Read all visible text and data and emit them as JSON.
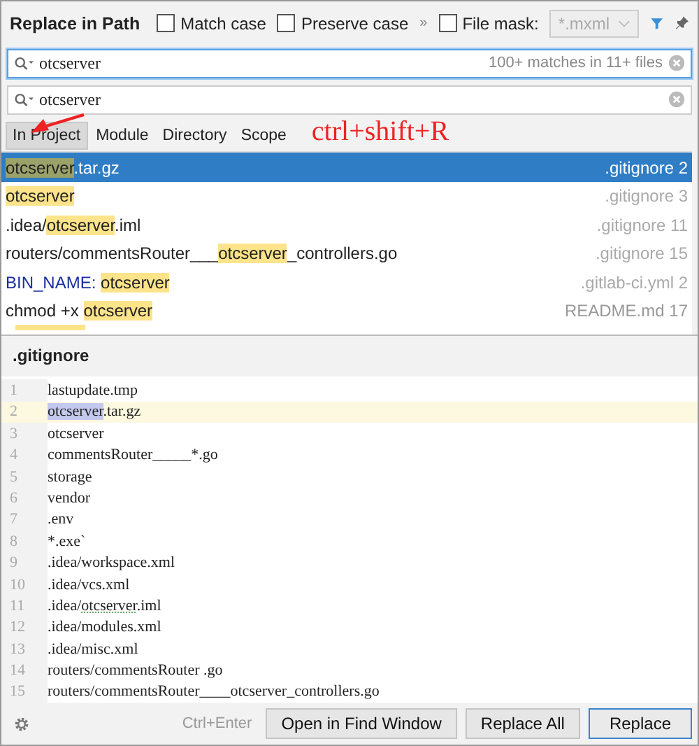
{
  "header": {
    "title": "Replace in Path",
    "options": [
      {
        "label": "Match case",
        "checked": false
      },
      {
        "label": "Preserve case",
        "checked": false
      }
    ],
    "more": "»",
    "file_mask": {
      "label": "File mask:",
      "checked": false,
      "value": "*.mxml",
      "disabled": true
    }
  },
  "search": {
    "value": "otcserver",
    "summary": "100+ matches in 11+ files"
  },
  "replace": {
    "value": "otcserver"
  },
  "scopes": [
    {
      "label": "In Project",
      "selected": true
    },
    {
      "label": "Module",
      "selected": false
    },
    {
      "label": "Directory",
      "selected": false
    },
    {
      "label": "Scope",
      "selected": false
    }
  ],
  "annotation": {
    "text": "ctrl+shift+R"
  },
  "results": [
    {
      "selected": true,
      "segments": [
        {
          "text": "otcserver",
          "kind": "match"
        },
        {
          "text": ".tar.gz",
          "kind": "plain"
        }
      ],
      "location": ".gitignore 2"
    },
    {
      "selected": false,
      "segments": [
        {
          "text": "otcserver",
          "kind": "match"
        }
      ],
      "location": ".gitignore 3"
    },
    {
      "selected": false,
      "segments": [
        {
          "text": ".idea/",
          "kind": "plain"
        },
        {
          "text": "otcserver",
          "kind": "match"
        },
        {
          "text": ".iml",
          "kind": "plain"
        }
      ],
      "location": ".gitignore 11"
    },
    {
      "selected": false,
      "segments": [
        {
          "text": "routers/commentsRouter___",
          "kind": "plain"
        },
        {
          "text": "otcserver",
          "kind": "match"
        },
        {
          "text": "_controllers.go",
          "kind": "plain"
        }
      ],
      "location": ".gitignore 15"
    },
    {
      "selected": false,
      "segments": [
        {
          "text": "BIN_NAME: ",
          "kind": "key"
        },
        {
          "text": "otcserver",
          "kind": "match"
        }
      ],
      "location": ".gitlab-ci.yml 2"
    },
    {
      "selected": false,
      "segments": [
        {
          "text": "chmod +x ",
          "kind": "plain"
        },
        {
          "text": "otcserver",
          "kind": "match"
        }
      ],
      "location": "README.md 17"
    }
  ],
  "preview": {
    "file": ".gitignore",
    "lines": [
      {
        "number": "1",
        "current": false,
        "segments": [
          {
            "text": "lastupdate.tmp",
            "kind": "plain"
          }
        ]
      },
      {
        "number": "2",
        "current": true,
        "segments": [
          {
            "text": "otcserver",
            "kind": "selection"
          },
          {
            "text": ".tar.gz",
            "kind": "plain"
          }
        ]
      },
      {
        "number": "3",
        "current": false,
        "segments": [
          {
            "text": "otcserver",
            "kind": "plain"
          }
        ]
      },
      {
        "number": "4",
        "current": false,
        "segments": [
          {
            "text": "commentsRouter_____*.go",
            "kind": "plain"
          }
        ]
      },
      {
        "number": "5",
        "current": false,
        "segments": [
          {
            "text": "storage",
            "kind": "plain"
          }
        ]
      },
      {
        "number": "6",
        "current": false,
        "segments": [
          {
            "text": "vendor",
            "kind": "plain"
          }
        ]
      },
      {
        "number": "7",
        "current": false,
        "segments": [
          {
            "text": ".env",
            "kind": "plain"
          }
        ]
      },
      {
        "number": "8",
        "current": false,
        "segments": [
          {
            "text": "*.exe`",
            "kind": "plain"
          }
        ]
      },
      {
        "number": "9",
        "current": false,
        "segments": [
          {
            "text": ".idea/workspace.xml",
            "kind": "plain"
          }
        ]
      },
      {
        "number": "10",
        "current": false,
        "segments": [
          {
            "text": ".idea/vcs.xml",
            "kind": "plain"
          }
        ]
      },
      {
        "number": "11",
        "current": false,
        "segments": [
          {
            "text": ".idea/",
            "kind": "plain"
          },
          {
            "text": "otcserver",
            "kind": "typo"
          },
          {
            "text": ".iml",
            "kind": "plain"
          }
        ]
      },
      {
        "number": "12",
        "current": false,
        "segments": [
          {
            "text": ".idea/modules.xml",
            "kind": "plain"
          }
        ]
      },
      {
        "number": "13",
        "current": false,
        "segments": [
          {
            "text": ".idea/misc.xml",
            "kind": "plain"
          }
        ]
      },
      {
        "number": "14",
        "current": false,
        "segments": [
          {
            "text": "routers/commentsRouter .go",
            "kind": "plain"
          }
        ]
      },
      {
        "number": "15",
        "current": false,
        "segments": [
          {
            "text": "routers/commentsRouter____otcserver_controllers.go",
            "kind": "plain"
          }
        ]
      }
    ]
  },
  "footer": {
    "shortcut": "Ctrl+Enter",
    "buttons": [
      {
        "label": "Open in Find Window",
        "kind": "normal"
      },
      {
        "label": "Replace All",
        "kind": "normal"
      },
      {
        "label": "Replace",
        "kind": "default"
      }
    ]
  }
}
